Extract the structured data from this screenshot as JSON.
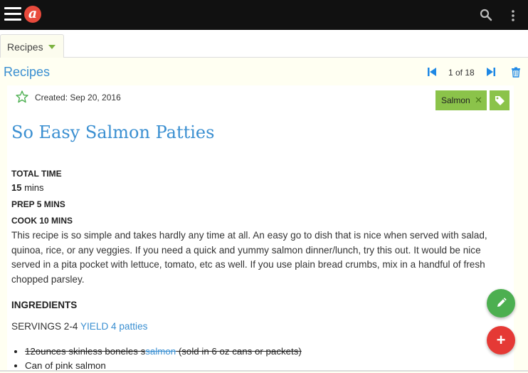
{
  "app": {
    "logo_letter": "a"
  },
  "tabs": [
    {
      "label": "Recipes"
    }
  ],
  "section": {
    "title": "Recipes",
    "pagination": "1 of 18"
  },
  "recipe": {
    "created": "Created: Sep 20, 2016",
    "tag": "Salmon",
    "tag_close": "✕",
    "title": "So Easy Salmon Patties",
    "total_time_label": "TOTAL TIME",
    "total_time_value": "15",
    "total_time_unit": " mins",
    "prep_label": "PREP 5 MINS",
    "cook_label": "COOK 10 MINS",
    "description": "This recipe is so simple and takes hardly any time at all. An easy go to dish that is nice when served with salad, quinoa, rice, or any veggies. If you need a quick and yummy salmon dinner/lunch, try this out. It would be nice served in a pita pocket with lettuce, tomato, etc as well. If you use plain bread crumbs, mix in a handful of fresh chopped parsley.",
    "ingredients_heading": "INGREDIENTS",
    "servings": "SERVINGS 2-4 ",
    "yield": "YIELD 4 patties",
    "ingredients": [
      {
        "before": "12ounces skinless boneles s",
        "link": "salmon",
        "after": " (sold in 6 oz cans or packets)"
      },
      {
        "text": "Can of pink salmon"
      }
    ]
  },
  "fab": {
    "add_glyph": "+"
  },
  "colors": {
    "accent_blue": "#3a8fd1",
    "tag_green": "#8bc34a",
    "edit_green": "#4caf50",
    "add_red": "#e53935",
    "topbar": "#111111"
  },
  "icons": [
    "hamburger-menu-icon",
    "app-logo",
    "search-icon",
    "more-vertical-icon",
    "chevron-down-icon",
    "skip-first-icon",
    "skip-next-icon",
    "trash-icon",
    "star-icon",
    "close-icon",
    "tag-icon",
    "pencil-icon",
    "plus-icon"
  ]
}
